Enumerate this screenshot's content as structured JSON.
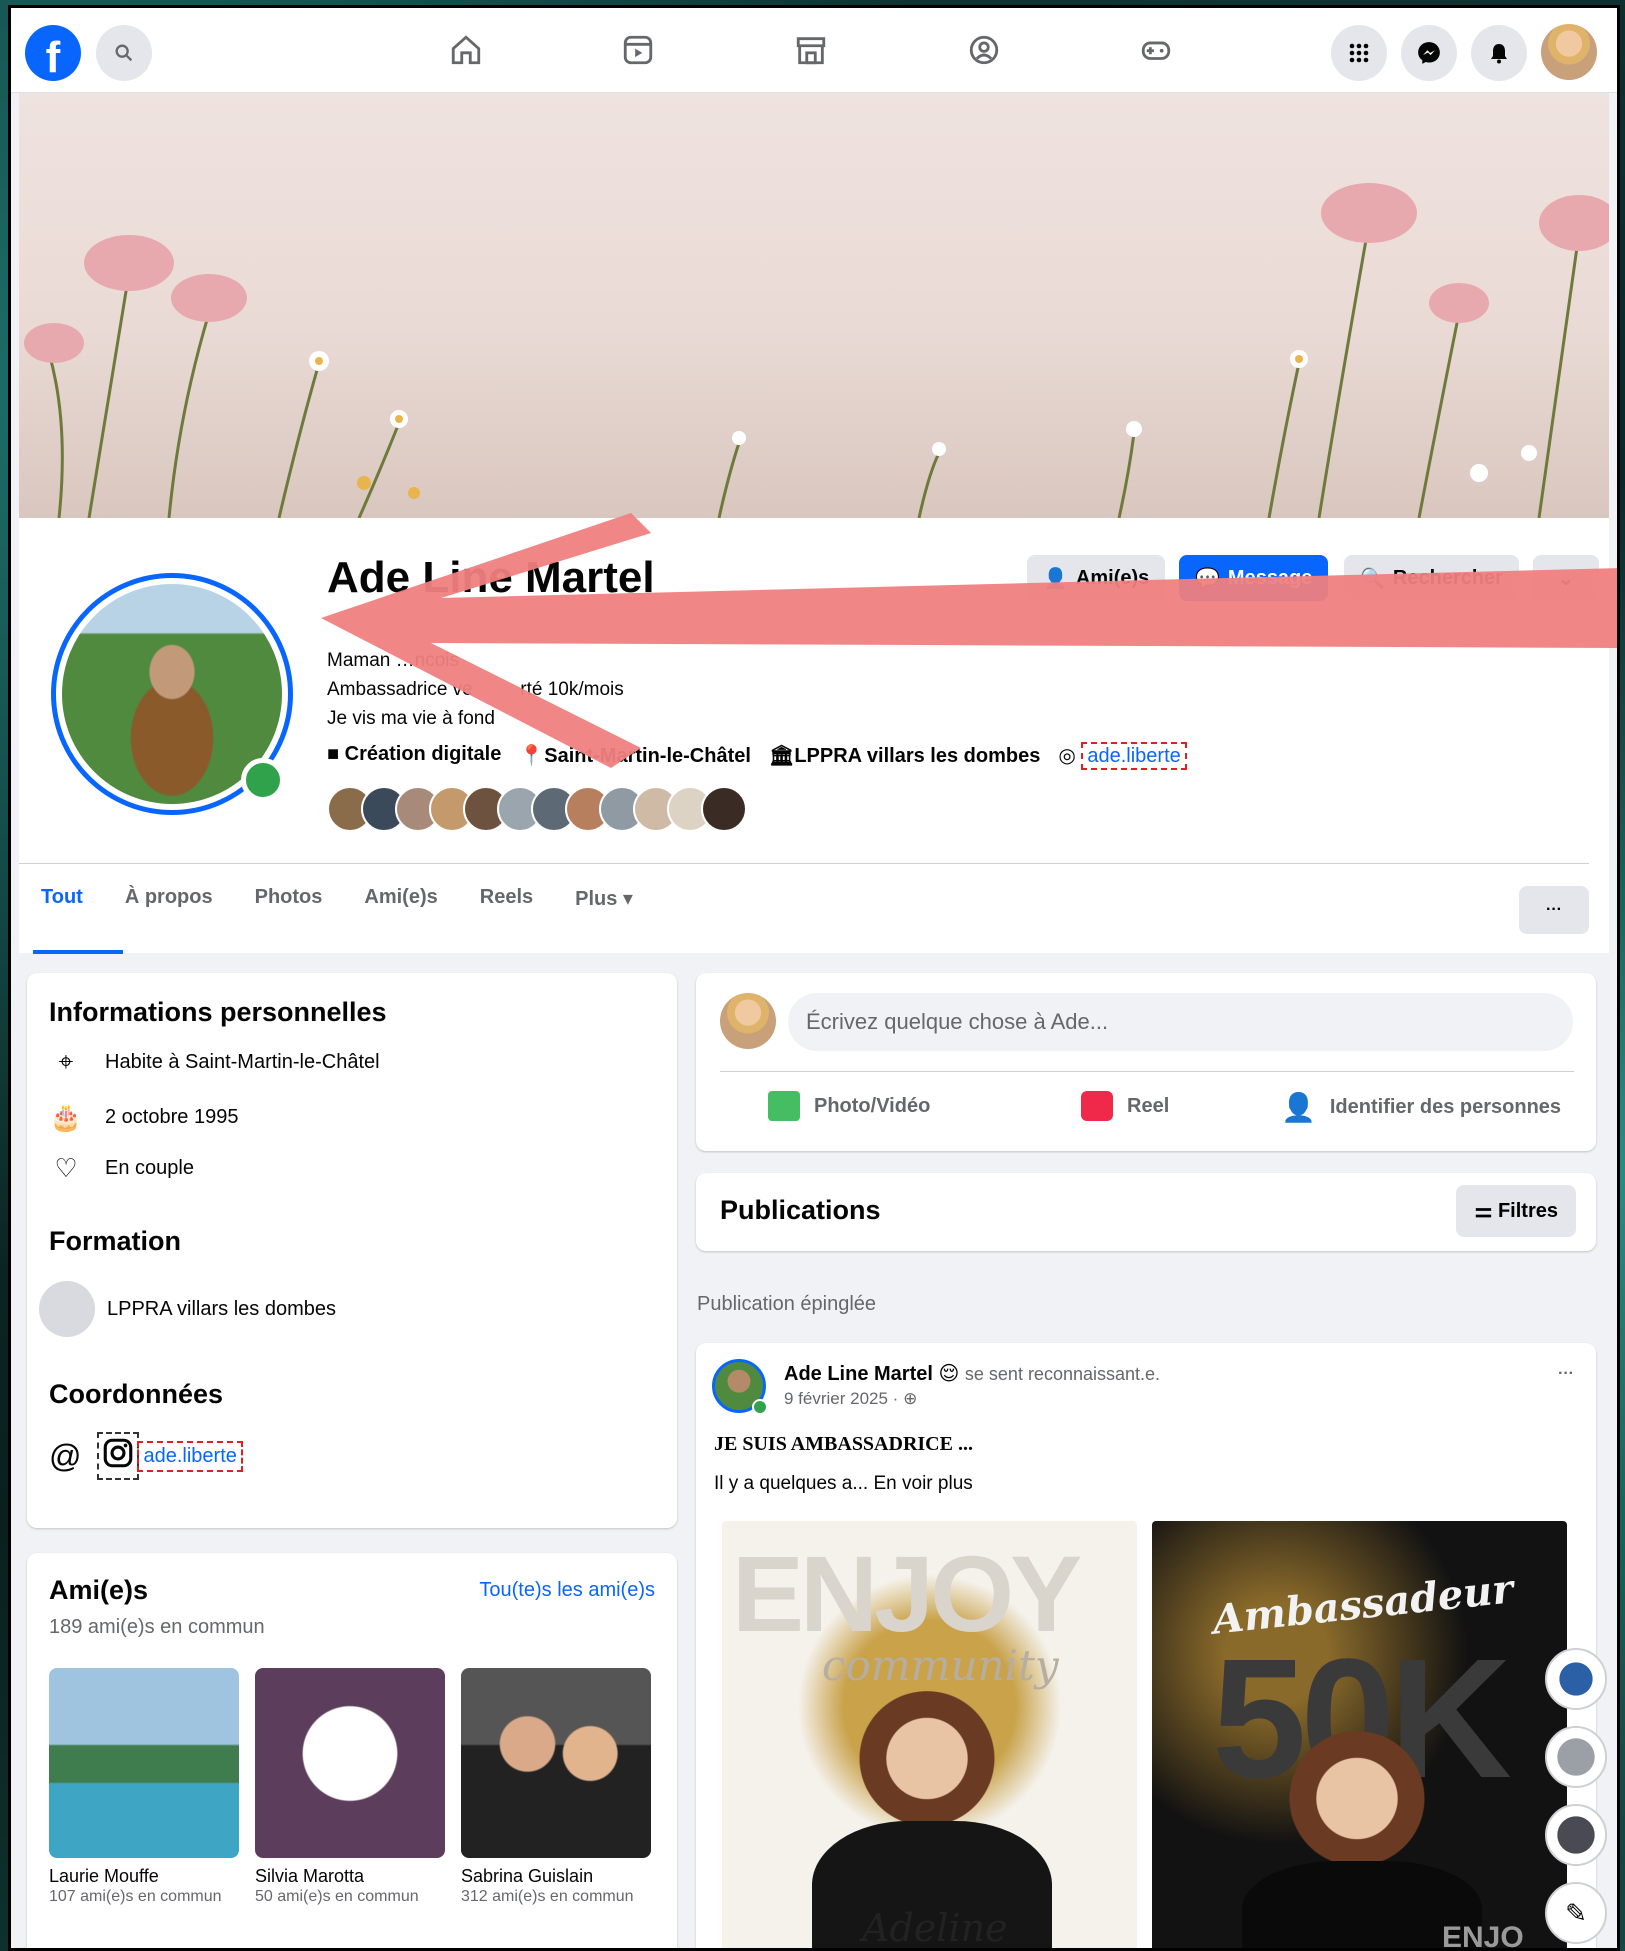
{
  "profile": {
    "name": "Ade Line Martel",
    "bio_line1": "Maman …ncois",
    "bio_line2_a": "Ambassadrice ve",
    "bio_line2_b": "rté 10k/mois",
    "bio_line3": "Je vis ma vie à fond",
    "meta": {
      "work": "Création digitale",
      "location": "Saint-Martin-le-Châtel",
      "school": "LPPRA villars les dombes",
      "instagram": "ade.liberte"
    }
  },
  "buttons": {
    "friends": "Ami(e)s",
    "message": "Message",
    "search": "Rechercher"
  },
  "tabs": [
    "Tout",
    "À propos",
    "Photos",
    "Ami(e)s",
    "Reels",
    "Plus"
  ],
  "intro": {
    "title": "Informations personnelles",
    "lives": "Habite à Saint-Martin-le-Châtel",
    "birthday": "2 octobre 1995",
    "relationship": "En couple",
    "education_title": "Formation",
    "school": "LPPRA villars les dombes",
    "contact_title": "Coordonnées",
    "instagram": "ade.liberte"
  },
  "friends": {
    "title": "Ami(e)s",
    "see_all": "Tou(te)s les ami(e)s",
    "mutual": "189 ami(e)s en commun",
    "list": [
      {
        "name": "Laurie Mouffe",
        "mutual": "107 ami(e)s en commun"
      },
      {
        "name": "Silvia Marotta",
        "mutual": "50 ami(e)s en commun"
      },
      {
        "name": "Sabrina Guislain",
        "mutual": "312 ami(e)s en commun"
      }
    ]
  },
  "composer": {
    "placeholder": "Écrivez quelque chose à Ade...",
    "photo": "Photo/Vidéo",
    "reel": "Reel",
    "tag": "Identifier des personnes"
  },
  "publications": {
    "title": "Publications",
    "filters": "Filtres",
    "pinned": "Publication épinglée"
  },
  "post": {
    "author": "Ade Line Martel",
    "feeling": "se sent reconnaissant.e.",
    "date": "9 février 2025 · ",
    "headline": "JE SUIS AMBASSADRICE ...",
    "text": "Il y a quelques a... En voir plus",
    "poster_left": {
      "top": "ENJOY",
      "script": "community",
      "name": "Adeline"
    },
    "poster_right": {
      "script": "Ambassadeur",
      "big": "50K",
      "brand": "ENJO"
    }
  },
  "colors": {
    "brand": "#0866ff",
    "online": "#31a24c",
    "arrow": "#f08080"
  }
}
